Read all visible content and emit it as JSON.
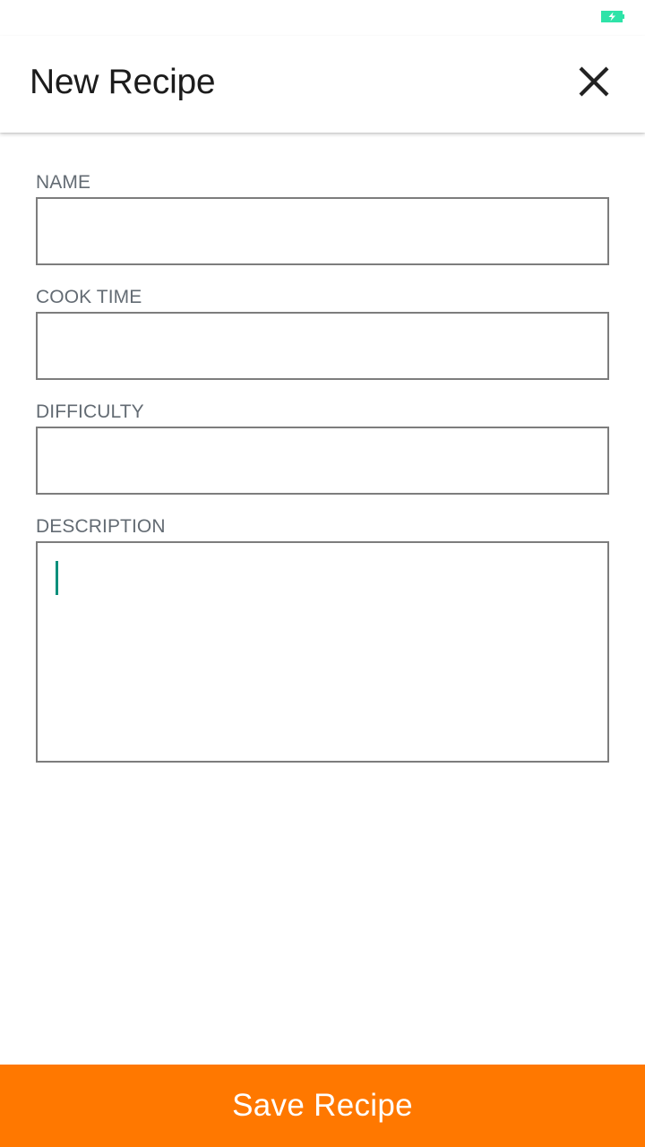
{
  "status_bar": {
    "battery_icon": "battery-charging-icon",
    "battery_color": "#2ee3a8"
  },
  "header": {
    "title": "New Recipe",
    "close_icon": "close-icon"
  },
  "form": {
    "fields": [
      {
        "label": "NAME",
        "value": "",
        "placeholder": ""
      },
      {
        "label": "COOK TIME",
        "value": "",
        "placeholder": ""
      },
      {
        "label": "DIFFICULTY",
        "value": "",
        "placeholder": ""
      },
      {
        "label": "DESCRIPTION",
        "value": "",
        "placeholder": ""
      }
    ],
    "focused_field": "DESCRIPTION",
    "cursor_color": "#0a8f7b"
  },
  "footer": {
    "save_label": "Save Recipe",
    "accent_color": "#ff7800"
  }
}
